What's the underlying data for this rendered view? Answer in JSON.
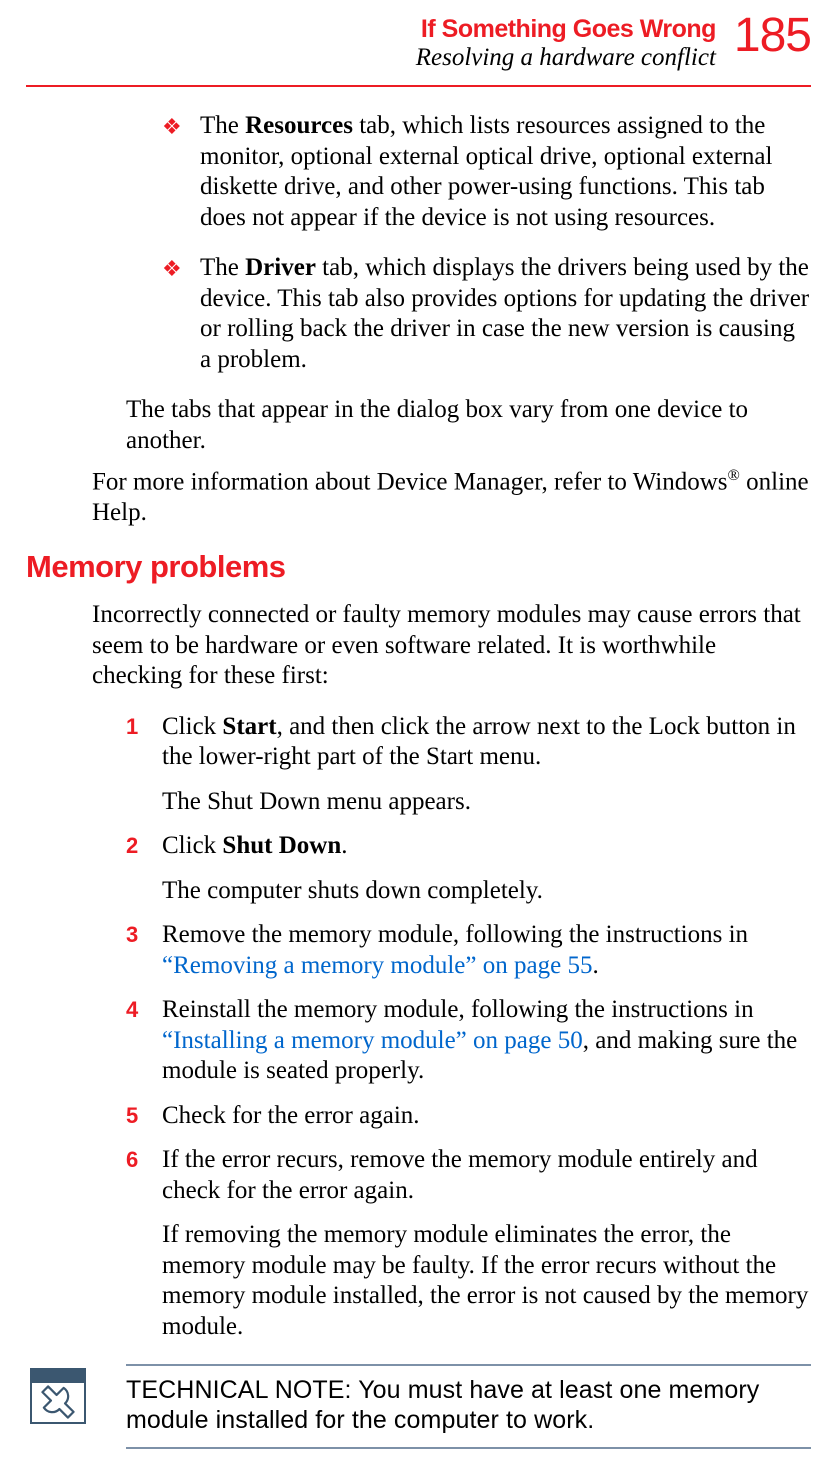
{
  "header": {
    "chapter": "If Something Goes Wrong",
    "section": "Resolving a hardware conflict",
    "page_number": "185"
  },
  "bullets": [
    {
      "prefix": "The ",
      "bold": "Resources",
      "rest": " tab, which lists resources assigned to the monitor, optional external optical drive, optional external diskette drive, and other power-using functions. This tab does not appear if the device is not using resources."
    },
    {
      "prefix": "The ",
      "bold": "Driver",
      "rest": " tab, which displays the drivers being used by the device. This tab also provides options for updating the driver or rolling back the driver in case the new version is causing a problem."
    }
  ],
  "tabs_note": "The tabs that appear in the dialog box vary from one device to another.",
  "device_manager_note": {
    "before": "For more information about Device Manager, refer to Windows",
    "sup": "®",
    "after": " online Help."
  },
  "heading": "Memory problems",
  "memory_intro": "Incorrectly connected or faulty memory modules may cause errors that seem to be hardware or even software related. It is worthwhile checking for these first:",
  "steps": {
    "s1": {
      "num": "1",
      "p1_before": "Click ",
      "p1_bold": "Start",
      "p1_after": ", and then click the arrow next to the Lock button in the lower-right part of the Start menu.",
      "p2": "The Shut Down menu appears."
    },
    "s2": {
      "num": "2",
      "p1_before": "Click ",
      "p1_bold": "Shut Down",
      "p1_after": ".",
      "p2": "The computer shuts down completely."
    },
    "s3": {
      "num": "3",
      "before": "Remove the memory module, following the instructions in ",
      "link": "“Removing a memory module” on page 55",
      "after": "."
    },
    "s4": {
      "num": "4",
      "before": "Reinstall the memory module, following the instructions in ",
      "link": "“Installing a memory module” on page 50",
      "after": ", and making sure the module is seated properly."
    },
    "s5": {
      "num": "5",
      "text": "Check for the error again."
    },
    "s6": {
      "num": "6",
      "p1": "If the error recurs, remove the memory module entirely and check for the error again.",
      "p2": "If removing the memory module eliminates the error, the memory module may be faulty. If the error recurs without the memory module installed, the error is not caused by the memory module."
    }
  },
  "tech_note": "TECHNICAL NOTE: You must have at least one memory module installed for the computer to work."
}
